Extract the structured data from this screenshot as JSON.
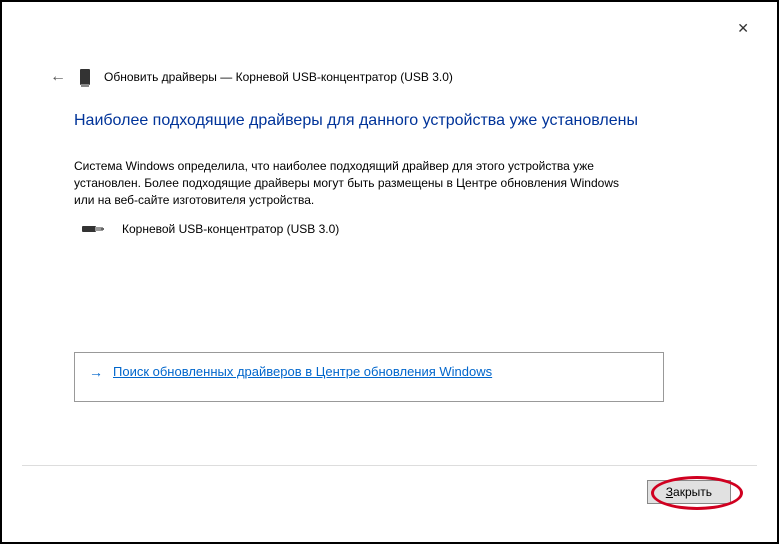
{
  "window": {
    "title": "Обновить драйверы — Корневой USB-концентратор (USB 3.0)"
  },
  "main": {
    "heading": "Наиболее подходящие драйверы для данного устройства уже установлены",
    "description": "Система Windows определила, что наиболее подходящий драйвер для этого устройства уже установлен. Более подходящие драйверы могут быть размещены в Центре обновления Windows или на веб-сайте изготовителя устройства.",
    "device_name": "Корневой USB-концентратор (USB 3.0)"
  },
  "link": {
    "text": "Поиск обновленных драйверов в Центре обновления Windows"
  },
  "footer": {
    "close_label": "Закрыть",
    "close_prefix": "З",
    "close_rest": "акрыть"
  }
}
